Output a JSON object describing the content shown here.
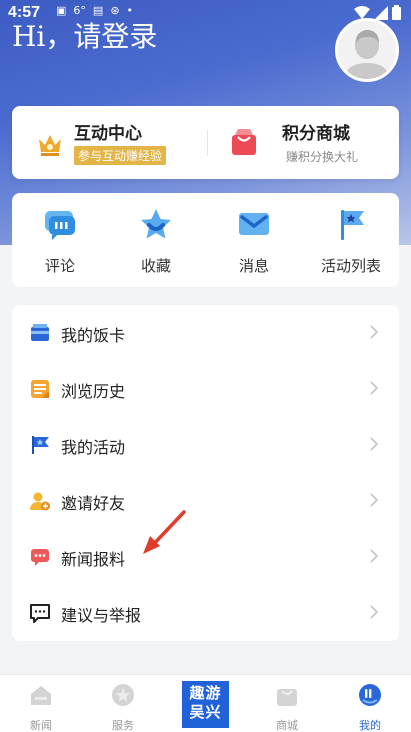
{
  "status_bar": {
    "time": "4:57",
    "temperature": "6°"
  },
  "header": {
    "login_prompt": "Hi，请登录"
  },
  "interaction_card": {
    "left_title": "互动中心",
    "left_badge": "参与互动赚经验",
    "right_title": "积分商城",
    "right_subtitle": "赚积分换大礼"
  },
  "quick_actions": [
    {
      "label": "评论",
      "icon": "comment-icon"
    },
    {
      "label": "收藏",
      "icon": "star-icon"
    },
    {
      "label": "消息",
      "icon": "message-icon"
    },
    {
      "label": "活动列表",
      "icon": "flag-icon"
    }
  ],
  "menu": [
    {
      "label": "我的饭卡",
      "icon": "card-icon"
    },
    {
      "label": "浏览历史",
      "icon": "history-icon"
    },
    {
      "label": "我的活动",
      "icon": "activity-flag-icon"
    },
    {
      "label": "邀请好友",
      "icon": "invite-user-icon"
    },
    {
      "label": "新闻报料",
      "icon": "news-tip-icon"
    },
    {
      "label": "建议与举报",
      "icon": "feedback-icon"
    }
  ],
  "bottom_nav": {
    "items": [
      {
        "label": "新闻",
        "icon": "home-icon"
      },
      {
        "label": "服务",
        "icon": "service-icon"
      },
      {
        "label": "商城",
        "icon": "shop-bag-icon"
      },
      {
        "label": "我的",
        "icon": "profile-icon"
      }
    ],
    "center_logo": {
      "line1": "趣游",
      "line2": "吴兴"
    },
    "active": "我的"
  },
  "colors": {
    "primary": "#2a67d9",
    "hero_start": "#3d5cc3",
    "badge_gold": "#e3b446",
    "annotation_red": "#e23b2a"
  }
}
